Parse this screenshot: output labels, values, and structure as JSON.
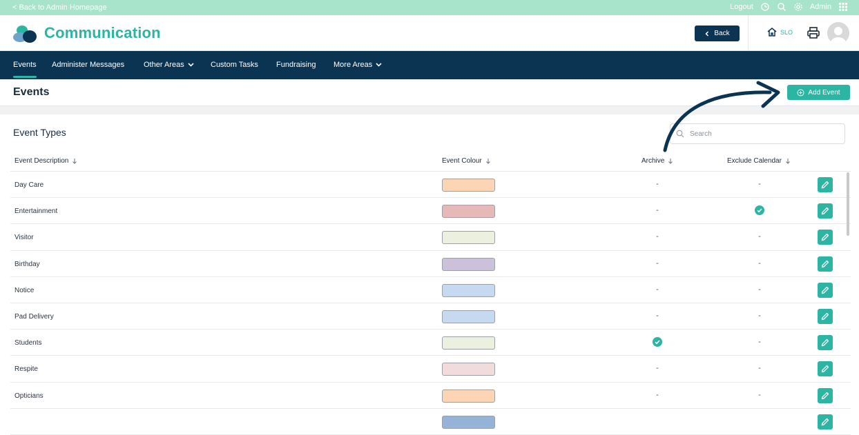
{
  "topbar": {
    "back_link": "< Back to Admin Homepage",
    "logout": "Logout",
    "admin": "Admin"
  },
  "header": {
    "app_title": "Communication",
    "back_button": "Back",
    "home_label": "SLO"
  },
  "nav": {
    "items": [
      {
        "label": "Events",
        "active": true
      },
      {
        "label": "Administer Messages"
      },
      {
        "label": "Other Areas",
        "dropdown": true
      },
      {
        "label": "Custom Tasks"
      },
      {
        "label": "Fundraising"
      },
      {
        "label": "More Areas",
        "dropdown": true
      }
    ]
  },
  "page": {
    "title": "Events",
    "add_button": "Add Event"
  },
  "event_types": {
    "title": "Event Types",
    "search_placeholder": "Search",
    "columns": {
      "description": "Event Description",
      "colour": "Event Colour",
      "archive": "Archive",
      "exclude_calendar": "Exclude Calendar"
    },
    "rows": [
      {
        "description": "Day Care",
        "colour": "#fcd5b4",
        "archive": "-",
        "exclude": "-"
      },
      {
        "description": "Entertainment",
        "colour": "#e6b8b7",
        "archive": "-",
        "exclude": "check"
      },
      {
        "description": "Visitor",
        "colour": "#ebf1de",
        "archive": "-",
        "exclude": "-"
      },
      {
        "description": "Birthday",
        "colour": "#ccc0da",
        "archive": "-",
        "exclude": "-"
      },
      {
        "description": "Notice",
        "colour": "#c5d9f1",
        "archive": "-",
        "exclude": "-"
      },
      {
        "description": "Pad Delivery",
        "colour": "#c5d9f1",
        "archive": "-",
        "exclude": "-"
      },
      {
        "description": "Students",
        "colour": "#ebf1de",
        "archive": "check",
        "exclude": "-"
      },
      {
        "description": "Respite",
        "colour": "#f2dcdb",
        "archive": "-",
        "exclude": "-"
      },
      {
        "description": "Opticians",
        "colour": "#fcd5b4",
        "archive": "-",
        "exclude": "-"
      },
      {
        "description": "",
        "colour": "#95b3d7",
        "archive": "",
        "exclude": ""
      }
    ]
  },
  "colors": {
    "accent": "#2bb5a2",
    "navy": "#0b3352",
    "topbar": "#a8e4cc"
  }
}
